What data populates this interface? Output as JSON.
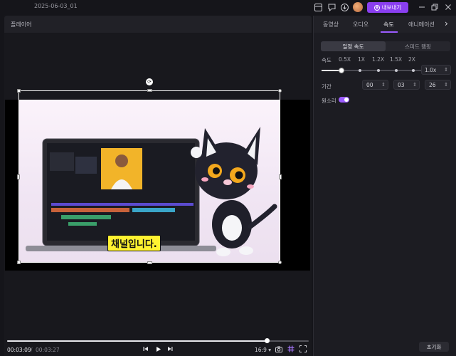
{
  "titlebar": {
    "project_name": "2025-06-03_01",
    "export_label": "내보내기"
  },
  "player": {
    "panel_title": "플레이어",
    "caption_text": "채널입니다.",
    "current_time": "00:03:09",
    "separator": "/",
    "total_time": "00:03:27",
    "aspect_ratio": "16:9",
    "progress": 0.86
  },
  "right_panel": {
    "tabs": [
      {
        "label": "동영상",
        "active": false
      },
      {
        "label": "오디오",
        "active": false
      },
      {
        "label": "속도",
        "active": true
      },
      {
        "label": "애니메이션",
        "active": false
      }
    ],
    "segments": [
      {
        "label": "일정 속도",
        "active": true
      },
      {
        "label": "스피드 램핑",
        "active": false
      }
    ],
    "speed_label": "속도",
    "speed_ticks": [
      "0.5X",
      "1X",
      "1.2X",
      "1.5X",
      "2X"
    ],
    "speed_value": "1.0x",
    "duration_label": "기간",
    "duration": {
      "hh": "00",
      "mm": "03",
      "ss": "26"
    },
    "original_sound_label": "원소리",
    "original_sound_on": true,
    "reset_label": "초기화"
  },
  "colors": {
    "accent": "#9b5cff",
    "export": "#8a3ff0",
    "caption_bg": "#fff231"
  }
}
